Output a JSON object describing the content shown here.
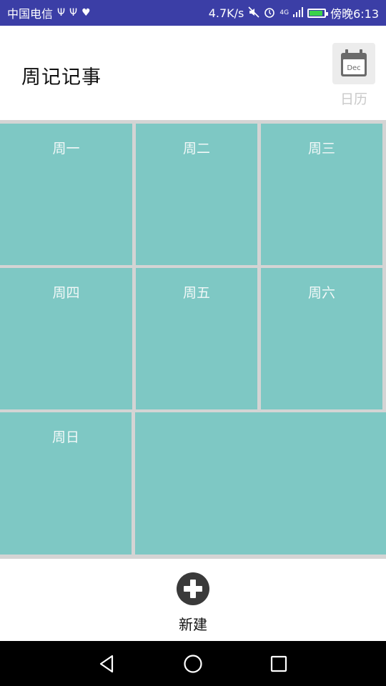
{
  "status_bar": {
    "carrier": "中国电信",
    "speed": "4.7K/s",
    "network": "4G",
    "time": "傍晚6:13",
    "battery_level": 0.9
  },
  "header": {
    "title": "周记记事",
    "calendar_icon_text": "Dec",
    "calendar_label": "日历"
  },
  "grid": {
    "cells": [
      {
        "label": "周一"
      },
      {
        "label": "周二"
      },
      {
        "label": "周三"
      },
      {
        "label": "周四"
      },
      {
        "label": "周五"
      },
      {
        "label": "周六"
      },
      {
        "label": "周日"
      },
      {
        "label": ""
      }
    ]
  },
  "bottom": {
    "new_label": "新建"
  },
  "colors": {
    "status_bar": "#3b3ea6",
    "tile": "#7ec8c4",
    "grid_gap": "#d4d4d4"
  }
}
